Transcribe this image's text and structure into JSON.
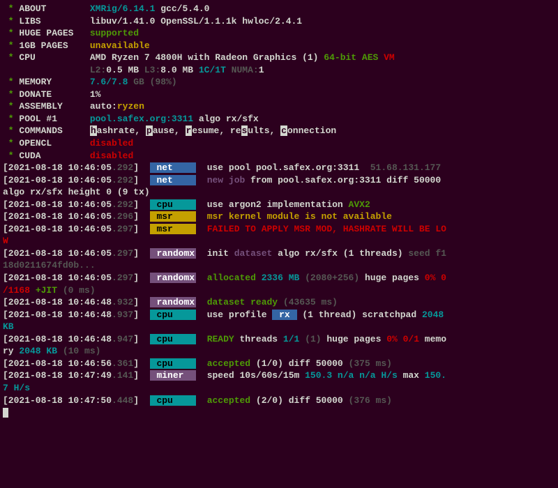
{
  "header": {
    "about_label": "ABOUT",
    "about_value_1": "XMRig/6.14.1",
    "about_value_2": " gcc/5.4.0",
    "libs_label": "LIBS",
    "libs_value": "libuv/1.41.0 OpenSSL/1.1.1k hwloc/2.4.1",
    "hugepages_label": "HUGE PAGES",
    "hugepages_value": "supported",
    "gbpages_label": "1GB PAGES",
    "gbpages_value": "unavailable",
    "cpu_label": "CPU",
    "cpu_name": "AMD Ryzen 7 4800H with Radeon Graphics (1) ",
    "cpu_flags_1": "64-bit ",
    "cpu_flags_2": "AES ",
    "cpu_flags_3": "VM",
    "cpu_l2_label": "L2:",
    "cpu_l2_val": "0.5 MB ",
    "cpu_l3_label": "L3:",
    "cpu_l3_val": "8.0 MB ",
    "cpu_threads": "1C/1T ",
    "cpu_numa_label": "NUMA:",
    "cpu_numa_val": "1",
    "mem_label": "MEMORY",
    "mem_value": "7.6/7.8 ",
    "mem_unit": "GB ",
    "mem_pct": "(98%)",
    "donate_label": "DONATE",
    "donate_value": "1%",
    "asm_label": "ASSEMBLY",
    "asm_auto": "auto:",
    "asm_arch": "ryzen",
    "pool_label": "POOL #1",
    "pool_url": "pool.safex.org:3311",
    "pool_algo": " algo rx/sfx",
    "cmd_label": "COMMANDS",
    "cmd_h": "h",
    "cmd_hash": "ashrate, ",
    "cmd_p": "p",
    "cmd_pause": "ause, ",
    "cmd_r": "r",
    "cmd_resume": "esume, re",
    "cmd_s": "s",
    "cmd_results": "ults, ",
    "cmd_c": "c",
    "cmd_conn": "onnection",
    "opencl_label": "OPENCL",
    "opencl_value": "disabled",
    "cuda_label": "CUDA",
    "cuda_value": "disabled"
  },
  "log": {
    "ts1": "[2021-08-18 10:46:05",
    "ts1m": ".292",
    "ts2": "[2021-08-18 10:46:05",
    "ts2m": ".296",
    "ts3": "[2021-08-18 10:46:05",
    "ts3m": ".297",
    "ts4": "[2021-08-18 10:46:48",
    "ts4m": ".932",
    "ts5": "[2021-08-18 10:46:48",
    "ts5m": ".937",
    "ts6": "[2021-08-18 10:46:48",
    "ts6m": ".947",
    "ts7": "[2021-08-18 10:46:56",
    "ts7m": ".361",
    "ts8": "[2021-08-18 10:47:49",
    "ts8m": ".141",
    "ts9": "[2021-08-18 10:47:50",
    "ts9m": ".448",
    "tag_net": " net    ",
    "tag_cpu": " cpu    ",
    "tag_msr": " msr    ",
    "tag_randomx": " randomx",
    "tag_miner": " miner  ",
    "net_use": "use pool ",
    "net_pool": "pool.safex.org:3311  ",
    "net_ip": "51.68.131.177",
    "net_newjob": "new job ",
    "net_from": "from pool.safex.org:3311 diff 50000 ",
    "net_algo": "algo rx/sfx height 0 (9 tx)",
    "cpu_argon": "use ",
    "cpu_argon2": "argon2",
    "cpu_impl": " implementation ",
    "cpu_avx": "AVX2",
    "msr_warn": "msr kernel module is not available",
    "msr_fail": "FAILED TO APPLY MSR MOD, HASHRATE WILL BE LO",
    "msr_fail_w": "W",
    "rx_init": "init ",
    "rx_dataset": "dataset",
    "rx_algo": " algo ",
    "rx_algoval": "rx/sfx",
    "rx_threads": " (1 threads) ",
    "rx_seed": "seed f1",
    "rx_seed2": "18d0211674fd0b...",
    "rx_alloc": "allocated ",
    "rx_mb": "2336 MB ",
    "rx_breakdown": "(2080+256) ",
    "rx_huge": "huge pages ",
    "rx_hugepct": "0% 0",
    "rx_jit1": "/1168 ",
    "rx_jit2": "+JIT ",
    "rx_jit3": "(0 ms)",
    "rx_ready": "dataset ready ",
    "rx_readyms": "(43635 ms)",
    "cpu_profile": "use profile ",
    "cpu_rx": " rx ",
    "cpu_thread": " (1 thread) scratchpad ",
    "cpu_scratch": "2048 ",
    "cpu_kb": "KB",
    "cpu_ready": "READY ",
    "cpu_ready_t": "threads ",
    "cpu_ready_n": "1/1 ",
    "cpu_ready_p": "(1) ",
    "cpu_ready_h": "huge pages ",
    "cpu_ready_hp": "0% 0/1 ",
    "cpu_ready_mem": "memo",
    "cpu_ready_mem2": "ry ",
    "cpu_ready_2048": "2048 KB ",
    "cpu_ready_ms": "(10 ms)",
    "acc1": "accepted ",
    "acc1_n": "(1/0) diff 50000 ",
    "acc1_ms": "(375 ms)",
    "speed": "speed 10s/60s/15m ",
    "speed_v": "150.3 n/a n/a ",
    "speed_hs": "H/s ",
    "speed_max": "max ",
    "speed_maxv": "150.",
    "speed_maxv2": "7 H/s",
    "acc2": "accepted ",
    "acc2_n": "(2/0) diff 50000 ",
    "acc2_ms": "(376 ms)"
  }
}
